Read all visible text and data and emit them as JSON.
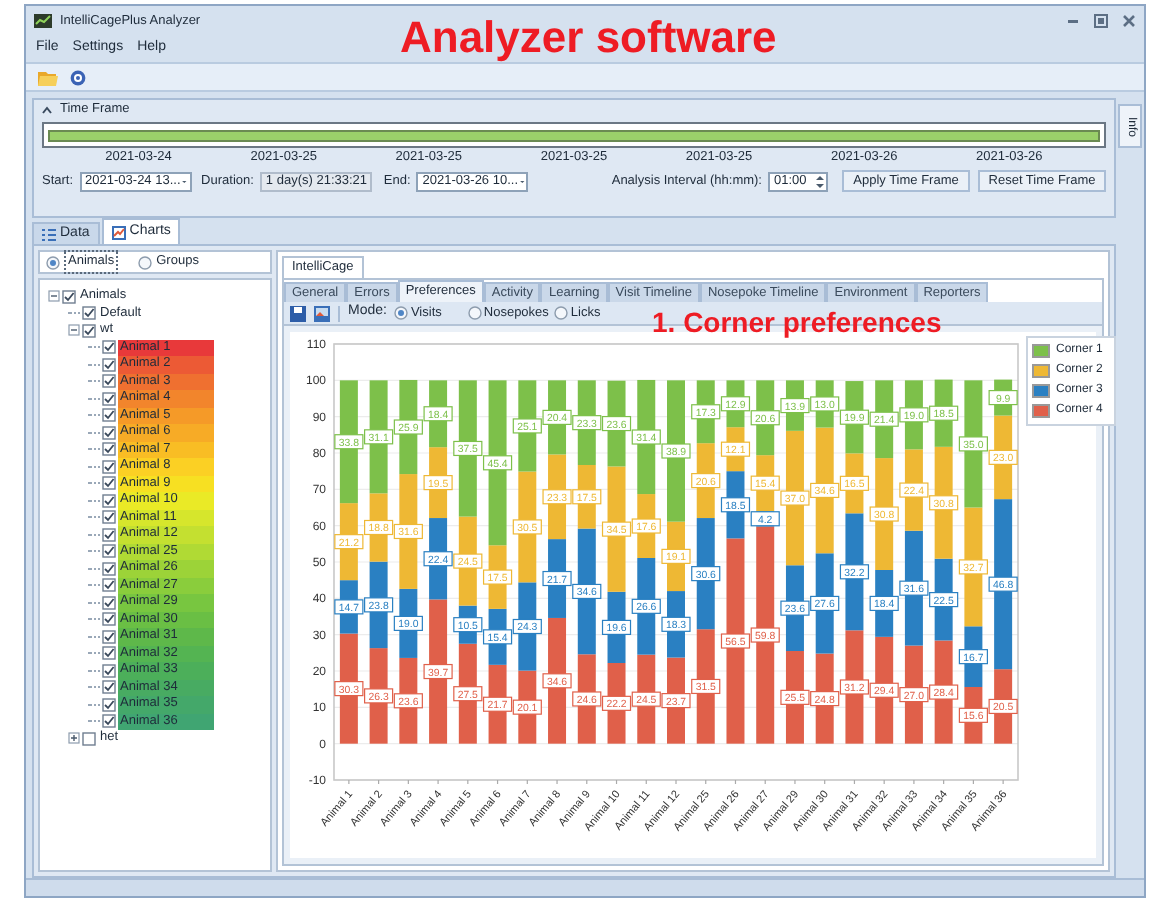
{
  "annotations": [
    {
      "kind": "title",
      "text": "Analyzer software"
    },
    {
      "kind": "caption",
      "text": "1. Corner preferences"
    }
  ],
  "window": {
    "title": "IntelliCagePlus Analyzer"
  },
  "menu": [
    "File",
    "Settings",
    "Help"
  ],
  "time_frame": {
    "title": "Time Frame",
    "expanded": true,
    "dates": [
      "2021-03-24",
      "2021-03-25",
      "2021-03-25",
      "2021-03-25",
      "2021-03-25",
      "2021-03-26",
      "2021-03-26"
    ],
    "start_label": "Start:",
    "start": "2021-03-24 13...",
    "duration_label": "Duration:",
    "duration": "1 day(s) 21:33:21",
    "end_label": "End:",
    "end": "2021-03-26 10...",
    "interval_label": "Analysis Interval (hh:mm):",
    "interval": "01:00",
    "buttons": [
      "Apply Time Frame",
      "Reset Time Frame"
    ]
  },
  "side_tab": "Info",
  "main_tabs": [
    {
      "label": "Data",
      "selected": false
    },
    {
      "label": "Charts",
      "selected": true
    }
  ],
  "selector": [
    {
      "label": "Animals",
      "selected": true
    },
    {
      "label": "Groups",
      "selected": false
    }
  ],
  "tree": [
    {
      "label": "Animals",
      "checked": true,
      "expanded": true,
      "children": [
        {
          "label": "Default",
          "checked": true
        },
        {
          "label": "wt",
          "checked": true,
          "expanded": true,
          "children": [
            {
              "label": "Animal 1",
              "checked": true,
              "color": "#e8393a"
            },
            {
              "label": "Animal 2",
              "checked": true,
              "color": "#ec5a35"
            },
            {
              "label": "Animal 3",
              "checked": true,
              "color": "#ef7030"
            },
            {
              "label": "Animal 4",
              "checked": true,
              "color": "#f2852c"
            },
            {
              "label": "Animal 5",
              "checked": true,
              "color": "#f59a28"
            },
            {
              "label": "Animal 6",
              "checked": true,
              "color": "#f7ab26"
            },
            {
              "label": "Animal 7",
              "checked": true,
              "color": "#f9bd24"
            },
            {
              "label": "Animal 8",
              "checked": true,
              "color": "#fbd024"
            },
            {
              "label": "Animal 9",
              "checked": true,
              "color": "#f7e022"
            },
            {
              "label": "Animal 10",
              "checked": true,
              "color": "#eaea26"
            },
            {
              "label": "Animal 11",
              "checked": true,
              "color": "#d6e62c"
            },
            {
              "label": "Animal 12",
              "checked": true,
              "color": "#c4e030"
            },
            {
              "label": "Animal 25",
              "checked": true,
              "color": "#b0da34"
            },
            {
              "label": "Animal 26",
              "checked": true,
              "color": "#9cd338"
            },
            {
              "label": "Animal 27",
              "checked": true,
              "color": "#8acd3c"
            },
            {
              "label": "Animal 29",
              "checked": true,
              "color": "#78c640"
            },
            {
              "label": "Animal 30",
              "checked": true,
              "color": "#6abf44"
            },
            {
              "label": "Animal 31",
              "checked": true,
              "color": "#5eb84a"
            },
            {
              "label": "Animal 32",
              "checked": true,
              "color": "#54b452"
            },
            {
              "label": "Animal 33",
              "checked": true,
              "color": "#4caf5a"
            },
            {
              "label": "Animal 34",
              "checked": true,
              "color": "#48ab62"
            },
            {
              "label": "Animal 35",
              "checked": true,
              "color": "#44a86a"
            },
            {
              "label": "Animal 36",
              "checked": true,
              "color": "#40a572"
            }
          ]
        },
        {
          "label": "het",
          "checked": false,
          "expanded": false
        }
      ]
    }
  ],
  "chart_tabs": [
    {
      "label": "IntelliCage",
      "selected": true
    }
  ],
  "sub_tabs": [
    {
      "label": "General",
      "selected": false
    },
    {
      "label": "Errors",
      "selected": false
    },
    {
      "label": "Preferences",
      "selected": true
    },
    {
      "label": "Activity",
      "selected": false
    },
    {
      "label": "Learning",
      "selected": false
    },
    {
      "label": "Visit Timeline",
      "selected": false
    },
    {
      "label": "Nosepoke Timeline",
      "selected": false
    },
    {
      "label": "Environment",
      "selected": false
    },
    {
      "label": "Reporters",
      "selected": false
    }
  ],
  "mode": {
    "label": "Mode:",
    "options": [
      {
        "label": "Visits",
        "selected": true
      },
      {
        "label": "Nosepokes",
        "selected": false
      },
      {
        "label": "Licks",
        "selected": false
      }
    ]
  },
  "chart_data": {
    "type": "bar",
    "stacked": true,
    "grid": true,
    "categories": [
      "Animal 1",
      "Animal 2",
      "Animal 3",
      "Animal 4",
      "Animal 5",
      "Animal 6",
      "Animal 7",
      "Animal 8",
      "Animal 9",
      "Animal 10",
      "Animal 11",
      "Animal 12",
      "Animal 25",
      "Animal 26",
      "Animal 27",
      "Animal 29",
      "Animal 30",
      "Animal 31",
      "Animal 32",
      "Animal 33",
      "Animal 34",
      "Animal 35",
      "Animal 36"
    ],
    "ylim": [
      -10,
      110
    ],
    "yticks": [
      -10,
      0,
      10,
      20,
      30,
      40,
      50,
      60,
      70,
      80,
      90,
      100,
      110
    ],
    "series": [
      {
        "name": "Corner 1",
        "color": "#7dc04a",
        "values": [
          33.8,
          31.1,
          25.9,
          18.4,
          37.5,
          45.4,
          25.1,
          20.4,
          23.3,
          23.6,
          31.4,
          38.9,
          17.3,
          12.9,
          20.6,
          13.9,
          13.0,
          19.9,
          21.4,
          19.0,
          18.5,
          35.0,
          9.9
        ],
        "value_labels": [
          "33.8",
          "31.1",
          "25.9",
          "18.4",
          "37.5",
          "45.4",
          "25.1",
          "20.4",
          "23.3",
          "23.6",
          "31.4",
          "38.9",
          "17.3",
          "12.9",
          "20.6",
          "13.9",
          "13.0",
          "19.9",
          "21.4",
          "19.0",
          "18.5",
          "35.0",
          "9.9"
        ]
      },
      {
        "name": "Corner 2",
        "color": "#eeb834",
        "values": [
          21.2,
          18.8,
          31.6,
          19.5,
          24.5,
          17.5,
          30.5,
          23.3,
          17.5,
          34.5,
          17.6,
          19.1,
          20.6,
          12.1,
          15.4,
          37.0,
          34.6,
          16.5,
          30.8,
          22.4,
          30.8,
          32.7,
          23.0
        ],
        "value_labels": [
          "21.2",
          "18.8",
          "31.6",
          "19.5",
          "24.5",
          "17.5",
          "30.5",
          "23.3",
          "17.5",
          "34.5",
          "17.6",
          "19.1",
          "20.6",
          "12.1",
          "15.4",
          "37.0",
          "34.6",
          "16.5",
          "30.8",
          "22.4",
          "30.8",
          "32.7",
          "23.0"
        ]
      },
      {
        "name": "Corner 3",
        "color": "#2a80c2",
        "values": [
          14.7,
          23.8,
          19.0,
          22.4,
          10.5,
          15.4,
          24.3,
          21.7,
          34.6,
          19.6,
          26.6,
          18.3,
          30.6,
          18.5,
          4.2,
          23.6,
          27.6,
          32.2,
          18.4,
          31.6,
          22.5,
          16.7,
          46.8
        ],
        "value_labels": [
          "14.7",
          "23.8",
          "19.0",
          "22.4",
          "10.5",
          "15.4",
          "24.3",
          "21.7",
          "34.6",
          "19.6",
          "26.6",
          "18.3",
          "30.6",
          "18.5",
          "4.2",
          "23.6",
          "27.6",
          "32.2",
          "18.4",
          "31.6",
          "22.5",
          "16.7",
          "46.8"
        ]
      },
      {
        "name": "Corner 4",
        "color": "#e0604a",
        "values": [
          30.3,
          26.3,
          23.6,
          39.7,
          27.5,
          21.7,
          20.1,
          34.6,
          24.6,
          22.2,
          24.5,
          23.7,
          31.5,
          56.5,
          59.8,
          25.5,
          24.8,
          31.2,
          29.4,
          27.0,
          28.4,
          15.6,
          20.5
        ],
        "value_labels": [
          "30.3",
          "26.3",
          "23.6",
          "39.7",
          "27.5",
          "21.7",
          "20.1",
          "34.6",
          "24.6",
          "22.2",
          "24.5",
          "23.7",
          "31.5",
          "56.5",
          "59.8",
          "25.5",
          "24.8",
          "31.2",
          "29.4",
          "27.0",
          "28.4",
          "15.6",
          "20.5"
        ]
      }
    ]
  }
}
